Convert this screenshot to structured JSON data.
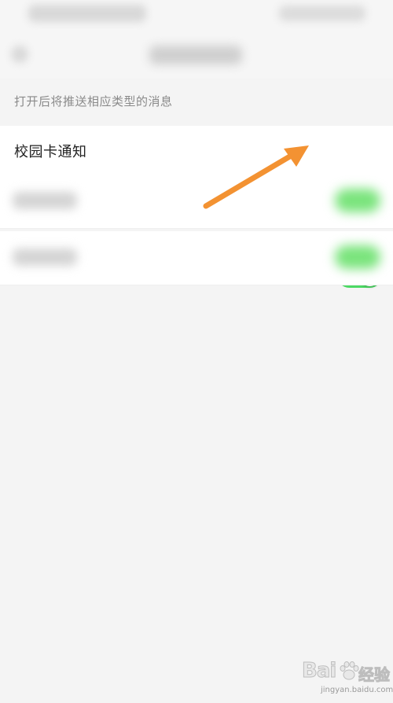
{
  "hint_text": "打开后将推送相应类型的消息",
  "rows": [
    {
      "label": "校园卡通知",
      "toggle_on": true
    }
  ],
  "colors": {
    "toggle_on": "#4cd964",
    "annotation_arrow": "#f39232",
    "background": "#f4f4f4"
  },
  "watermark": {
    "brand": "Bai",
    "suffix": "经验",
    "url": "jingyan.baidu.com"
  }
}
